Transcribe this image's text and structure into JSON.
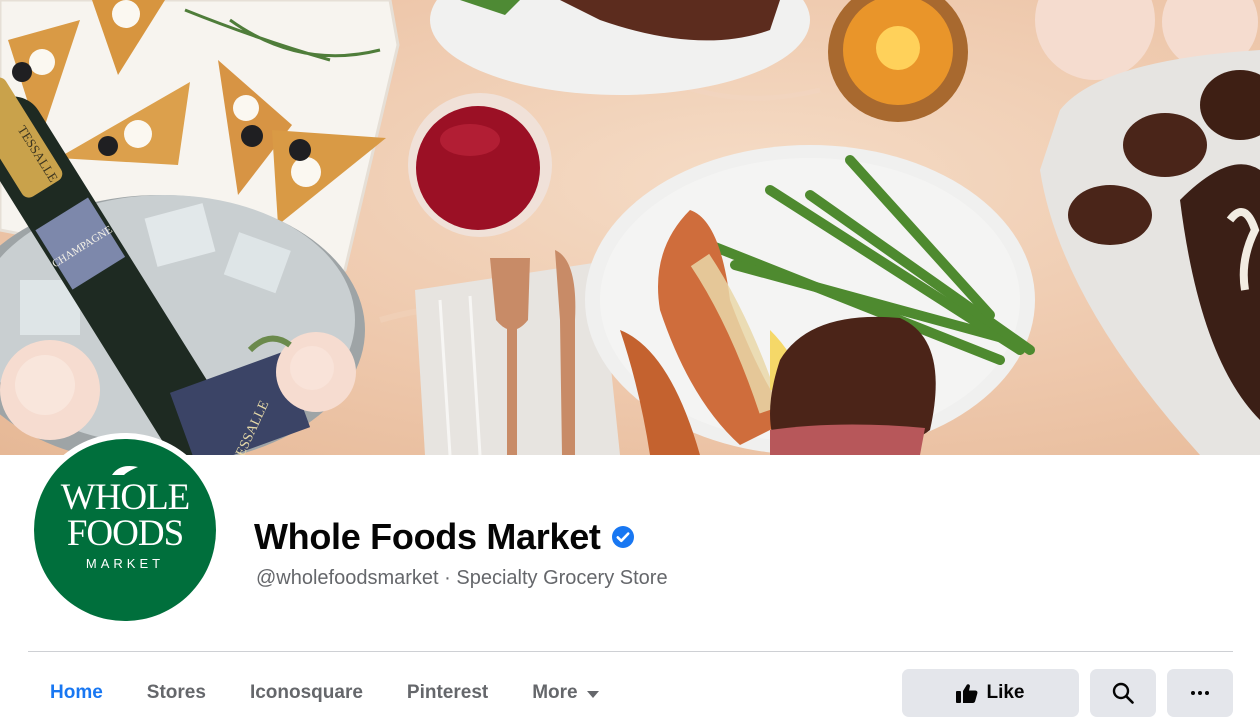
{
  "page": {
    "name": "Whole Foods Market",
    "handle_line": "@wholefoodsmarket · Specialty Grocery Store",
    "verified": true
  },
  "logo": {
    "line1": "WHOLE",
    "line2": "FOODS",
    "line3": "MARKET",
    "brand_color": "#006f3c"
  },
  "cover": {
    "bottle_label_1": "TESSALLE",
    "bottle_label_2": "CHAMPAGNE",
    "bucket_label": "ESSALLE"
  },
  "tabs": [
    {
      "label": "Home",
      "active": true
    },
    {
      "label": "Stores",
      "active": false
    },
    {
      "label": "Iconosquare",
      "active": false
    },
    {
      "label": "Pinterest",
      "active": false
    },
    {
      "label": "More",
      "active": false
    }
  ],
  "actions": {
    "like_label": "Like",
    "like_icon": "thumbs-up-icon",
    "search_icon": "search-icon",
    "more_icon": "ellipsis-icon"
  },
  "colors": {
    "accent": "#1877f2",
    "secondary_text": "#65676b",
    "button_bg": "#e4e6eb"
  }
}
